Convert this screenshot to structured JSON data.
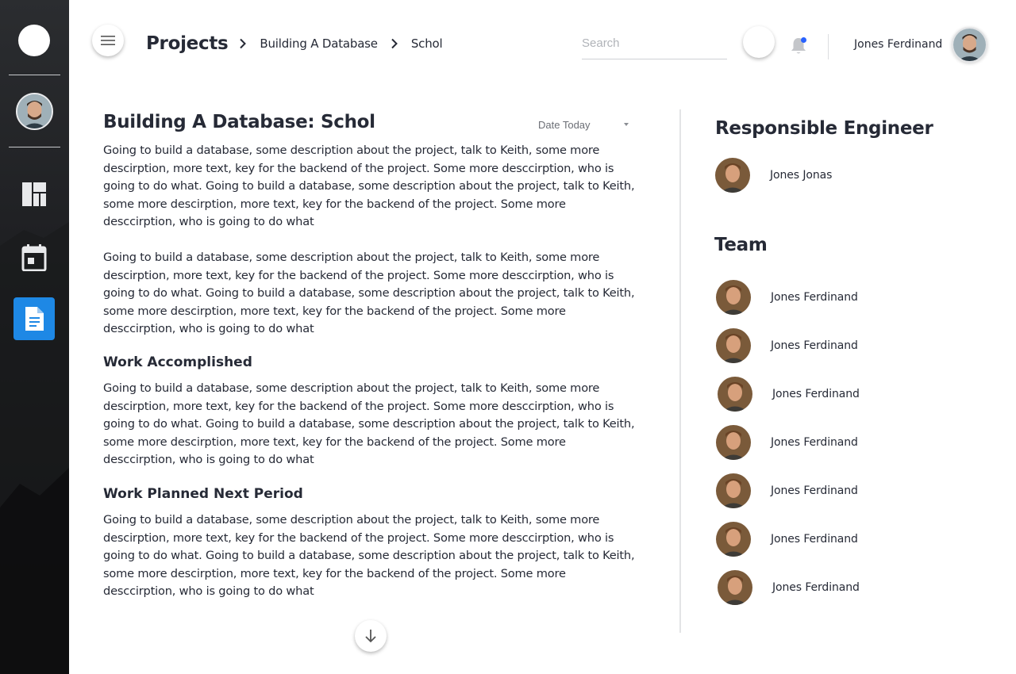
{
  "header": {
    "menu_icon": "hamburger-menu-icon",
    "breadcrumb": [
      "Projects",
      "Building A Database",
      "Schol"
    ],
    "search_placeholder": "Search",
    "user_name": "Jones Ferdinand",
    "notification_icon": "bell-icon"
  },
  "sidebar": {
    "items": [
      {
        "icon": "dashboard-icon"
      },
      {
        "icon": "calendar-icon"
      },
      {
        "icon": "document-icon",
        "active": true
      }
    ],
    "accent_color": "#1e88e5"
  },
  "main": {
    "title": "Building A Database: Schol",
    "date_filter": "Date Today",
    "paragraph_1": "Going to build a database, some description about the project, talk to Keith, some more descirption, more text, key for the backend of the project. Some more desccirption, who is going to do what. Going to build a database, some description about the project, talk to Keith, some more descirption, more text, key for the backend of the project. Some more desccirption, who is going to do what",
    "paragraph_2": "Going to build a database, some description about the project, talk to Keith, some more descirption, more text, key for the backend of the project. Some more desccirption, who is going to do what. Going to build a database, some description about the project, talk to Keith, some more descirption, more text, key for the backend of the project. Some more desccirption, who is going to do what",
    "section_1_title": "Work Accomplished",
    "section_1_text": "Going to build a database, some description about the project, talk to Keith, some more descirption, more text, key for the backend of the project. Some more desccirption, who is going to do what. Going to build a database, some description about the project, talk to Keith, some more descirption, more text, key for the backend of the project. Some more desccirption, who is going to do what",
    "section_2_title": "Work Planned Next Period",
    "section_2_text": "Going to build a database, some description about the project, talk to Keith, some more descirption, more text, key for the backend of the project. Some more desccirption, who is going to do what. Going to build a database, some description about the project, talk to Keith, some more descirption, more text, key for the backend of the project. Some more desccirption, who is going to do what"
  },
  "right": {
    "engineer_title": "Responsible Engineer",
    "engineer_name": "Jones Jonas",
    "team_title": "Team",
    "team": [
      "Jones Ferdinand",
      "Jones Ferdinand",
      "Jones Ferdinand",
      "Jones Ferdinand",
      "Jones Ferdinand",
      "Jones Ferdinand",
      "Jones Ferdinand"
    ]
  }
}
